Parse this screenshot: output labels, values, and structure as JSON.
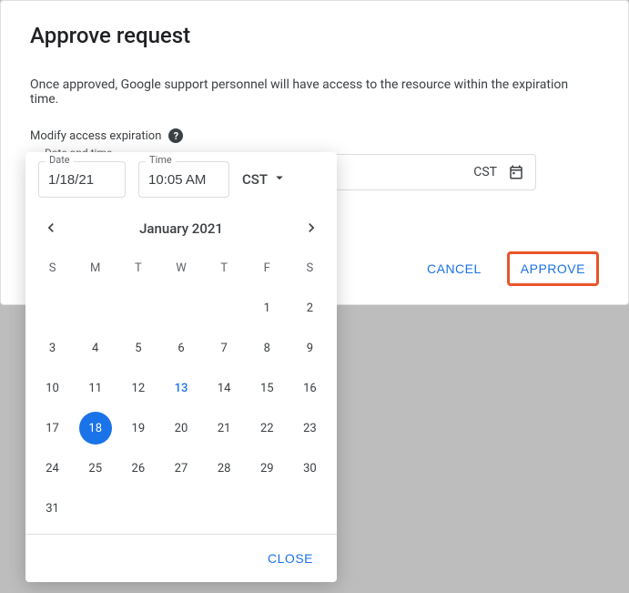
{
  "modal": {
    "title": "Approve request",
    "description": "Once approved, Google support personnel will have access to the resource within the expiration time.",
    "modify_label": "Modify access expiration",
    "date_field_label": "Date and time",
    "timezone": "CST",
    "cancel_label": "CANCEL",
    "approve_label": "APPROVE"
  },
  "picker": {
    "date_label": "Date",
    "date_value": "1/18/21",
    "time_label": "Time",
    "time_value": "10:05 AM",
    "timezone": "CST",
    "month_label": "January 2021",
    "dow": [
      "S",
      "M",
      "T",
      "W",
      "T",
      "F",
      "S"
    ],
    "weeks": [
      [
        "",
        "",
        "",
        "",
        "",
        "1",
        "2"
      ],
      [
        "3",
        "4",
        "5",
        "6",
        "7",
        "8",
        "9"
      ],
      [
        "10",
        "11",
        "12",
        "13",
        "14",
        "15",
        "16"
      ],
      [
        "17",
        "18",
        "19",
        "20",
        "21",
        "22",
        "23"
      ],
      [
        "24",
        "25",
        "26",
        "27",
        "28",
        "29",
        "30"
      ],
      [
        "31",
        "",
        "",
        "",
        "",
        "",
        ""
      ]
    ],
    "today": "13",
    "selected": "18",
    "close_label": "CLOSE"
  }
}
